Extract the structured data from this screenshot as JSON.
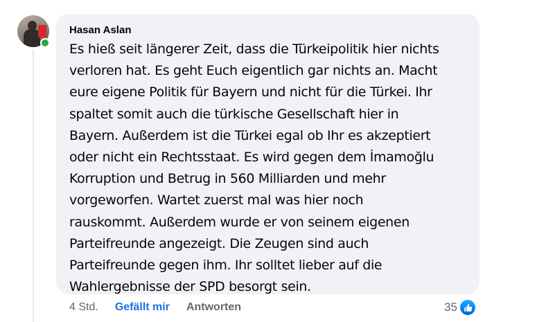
{
  "comment": {
    "author": "Hasan Aslan",
    "lines": [
      "Es hieß seit längerer Zeit, dass die Türkeipolitik hier nichts",
      "verloren hat. Es geht Euch eigentlich gar nichts an. Macht",
      "eure eigene Politik für Bayern und nicht für die Türkei. Ihr",
      "spaltet somit auch die türkische Gesellschaft hier in",
      "Bayern. Außerdem ist die Türkei egal ob Ihr es akzeptiert",
      "oder nicht ein Rechtsstaat. Es wird gegen dem İmamoğlu",
      "Korruption und Betrug in 560 Milliarden und mehr",
      "vorgeworfen. Wartet zuerst mal was hier noch",
      "rauskommt. Außerdem wurde er von seinem eigenen",
      "Parteifreunde angezeigt. Die Zeugen sind auch",
      "Parteifreunde gegen ihm. Ihr solltet lieber auf die",
      "Wahlergebnisse der SPD besorgt sein."
    ],
    "online": true
  },
  "actions": {
    "timestamp": "4 Std.",
    "like_label": "Gefällt mir",
    "reply_label": "Antworten"
  },
  "reactions": {
    "count": "35",
    "icon": "thumbs-up-icon"
  },
  "colors": {
    "bubble_bg": "#f0f2f5",
    "like_active": "#1d72e8",
    "secondary_text": "#65676b",
    "online": "#31a24c",
    "like_badge": "#1877f2"
  }
}
